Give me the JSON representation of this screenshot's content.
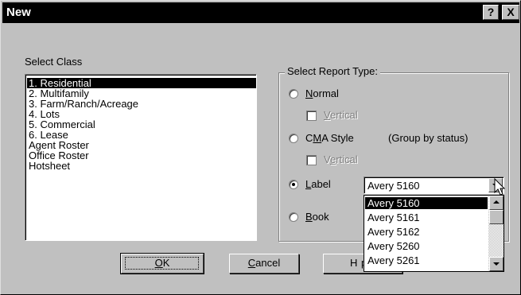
{
  "window": {
    "title": "New",
    "help_glyph": "?",
    "close_glyph": "X"
  },
  "select_class": {
    "label": "Select Class",
    "items": [
      {
        "label": "1. Residential",
        "selected": true
      },
      {
        "label": "2. Multifamily"
      },
      {
        "label": "3. Farm/Ranch/Acreage"
      },
      {
        "label": "4. Lots"
      },
      {
        "label": "5. Commercial"
      },
      {
        "label": "6. Lease"
      },
      {
        "label": "Agent Roster"
      },
      {
        "label": "Office Roster"
      },
      {
        "label": "Hotsheet"
      }
    ]
  },
  "report_type": {
    "legend": "Select Report Type:",
    "normal": {
      "label_u": "N",
      "label_rest": "ormal",
      "checked": false
    },
    "normal_vertical": {
      "label_u": "V",
      "label_rest": "ertical",
      "disabled": true
    },
    "cma": {
      "label_pre": "C",
      "label_u": "M",
      "label_rest": "A Style",
      "note": "(Group by status)",
      "checked": false
    },
    "cma_vertical": {
      "label_pre": "V",
      "label_u": "e",
      "label_rest": "rtical",
      "disabled": true
    },
    "label": {
      "label_u": "L",
      "label_rest": "abel",
      "checked": true
    },
    "book": {
      "label_u": "B",
      "label_rest": "ook",
      "checked": false
    }
  },
  "label_combo": {
    "value": "Avery 5160",
    "options": [
      {
        "label": "Avery 5160",
        "selected": true
      },
      {
        "label": "Avery 5161"
      },
      {
        "label": "Avery 5162"
      },
      {
        "label": "Avery 5260"
      },
      {
        "label": "Avery 5261"
      }
    ]
  },
  "buttons": {
    "ok": {
      "label_u": "O",
      "label_rest": "K"
    },
    "cancel": {
      "label_u": "C",
      "label_rest": "ancel"
    },
    "help": {
      "label_pre": "H",
      "label_rest": "p"
    }
  }
}
